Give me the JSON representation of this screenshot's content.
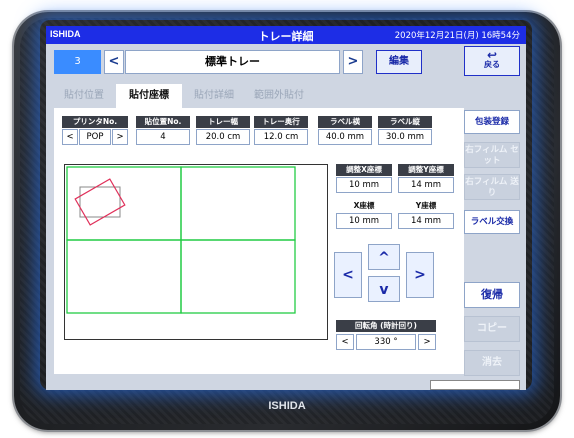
{
  "titlebar": {
    "logo": "ISHIDA",
    "title": "トレー詳細",
    "datetime": "2020年12月21日(月) 16時54分"
  },
  "topbar": {
    "tray_no": "3",
    "prev": "<",
    "next": ">",
    "tray_name": "標準トレー",
    "edit": "編集",
    "back": "戻る"
  },
  "tabs": [
    "貼付位置",
    "貼付座標",
    "貼付詳細",
    "範囲外貼付"
  ],
  "fields": {
    "printer": {
      "label": "プリンタNo.",
      "value": "POP",
      "prev": "<",
      "next": ">"
    },
    "position_no": {
      "label": "貼位置No.",
      "value": "4"
    },
    "tray_width": {
      "label": "トレー幅",
      "value": "20.0 cm"
    },
    "tray_depth": {
      "label": "トレー奥行",
      "value": "12.0 cm"
    },
    "label_width": {
      "label": "ラベル横",
      "value": "40.0 mm"
    },
    "label_height": {
      "label": "ラベル縦",
      "value": "30.0 mm"
    },
    "adj_x": {
      "label": "調整X座標",
      "value": "10 mm"
    },
    "adj_y": {
      "label": "調整Y座標",
      "value": "14 mm"
    },
    "x": {
      "label": "X座標",
      "value": "10 mm"
    },
    "y": {
      "label": "Y座標",
      "value": "14 mm"
    },
    "rotation": {
      "label": "回転角 (時計回り)",
      "value": "330 °",
      "prev": "<",
      "next": ">"
    }
  },
  "arrows": {
    "up": "^",
    "down": "v",
    "left": "<",
    "right": ">"
  },
  "side_buttons": [
    {
      "label": "包装登録",
      "enabled": true
    },
    {
      "label": "右フィルム セット",
      "enabled": false
    },
    {
      "label": "右フィルム 送り",
      "enabled": false
    },
    {
      "label": "ラベル交換",
      "enabled": true
    },
    {
      "label": "復帰",
      "enabled": true
    },
    {
      "label": "コピー",
      "enabled": false
    },
    {
      "label": "消去",
      "enabled": false
    }
  ],
  "bezel_logo": "ISHIDA",
  "colors": {
    "titlebar": "#1d2de6",
    "accent": "#3a8cff",
    "grid": "#22cc44",
    "label_outline": "#e0305a"
  }
}
